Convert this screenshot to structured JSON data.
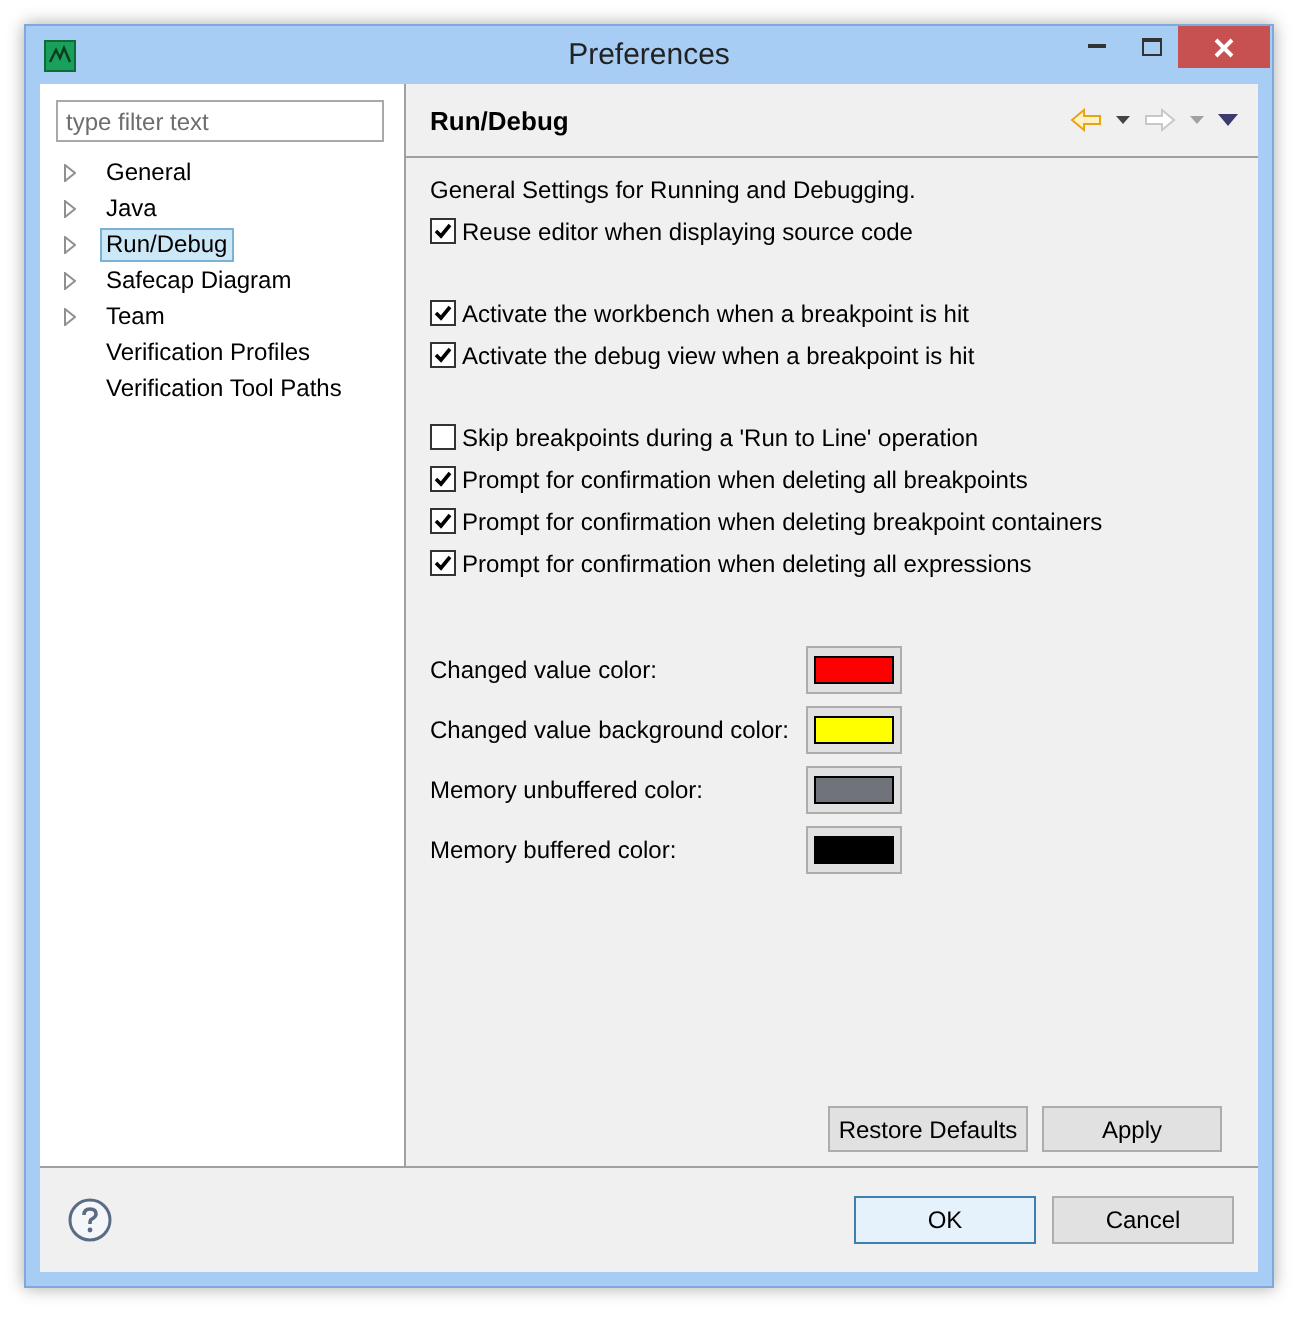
{
  "window": {
    "title": "Preferences"
  },
  "filter": {
    "placeholder": "type filter text"
  },
  "tree": {
    "items": [
      {
        "label": "General",
        "kind": "branch",
        "selected": false
      },
      {
        "label": "Java",
        "kind": "branch",
        "selected": false
      },
      {
        "label": "Run/Debug",
        "kind": "branch",
        "selected": true
      },
      {
        "label": "Safecap Diagram",
        "kind": "branch",
        "selected": false
      },
      {
        "label": "Team",
        "kind": "branch",
        "selected": false
      },
      {
        "label": "Verification Profiles",
        "kind": "leaf",
        "selected": false
      },
      {
        "label": "Verification Tool Paths",
        "kind": "leaf",
        "selected": false
      }
    ]
  },
  "page": {
    "title": "Run/Debug",
    "toolbar": [
      {
        "kind": "back",
        "disabled": false
      },
      {
        "kind": "dropdown",
        "disabled": false
      },
      {
        "kind": "forward",
        "disabled": true
      },
      {
        "kind": "dropdown",
        "disabled": true
      },
      {
        "kind": "menu",
        "disabled": false
      }
    ],
    "description": "General Settings for Running and Debugging.",
    "option_groups": [
      {
        "options": [
          {
            "label": "Reuse editor when displaying source code",
            "checked": true
          }
        ]
      },
      {
        "options": [
          {
            "label": "Activate the workbench when a breakpoint is hit",
            "checked": true
          },
          {
            "label": "Activate the debug view when a breakpoint is hit",
            "checked": true
          }
        ]
      },
      {
        "options": [
          {
            "label": "Skip breakpoints during a 'Run to Line' operation",
            "checked": false
          },
          {
            "label": "Prompt for confirmation when deleting all breakpoints",
            "checked": true
          },
          {
            "label": "Prompt for confirmation when deleting breakpoint containers",
            "checked": true
          },
          {
            "label": "Prompt for confirmation when deleting all expressions",
            "checked": true
          }
        ]
      }
    ],
    "colors": [
      {
        "label": "Changed value color:",
        "color": "#ff0000"
      },
      {
        "label": "Changed value background color:",
        "color": "#ffff00"
      },
      {
        "label": "Memory unbuffered color:",
        "color": "#70737a"
      },
      {
        "label": "Memory buffered color:",
        "color": "#000000"
      }
    ],
    "buttons": [
      "Restore Defaults",
      "Apply"
    ]
  },
  "footer": {
    "buttons": [
      {
        "label": "OK",
        "selected": true
      },
      {
        "label": "Cancel",
        "selected": false
      }
    ]
  }
}
